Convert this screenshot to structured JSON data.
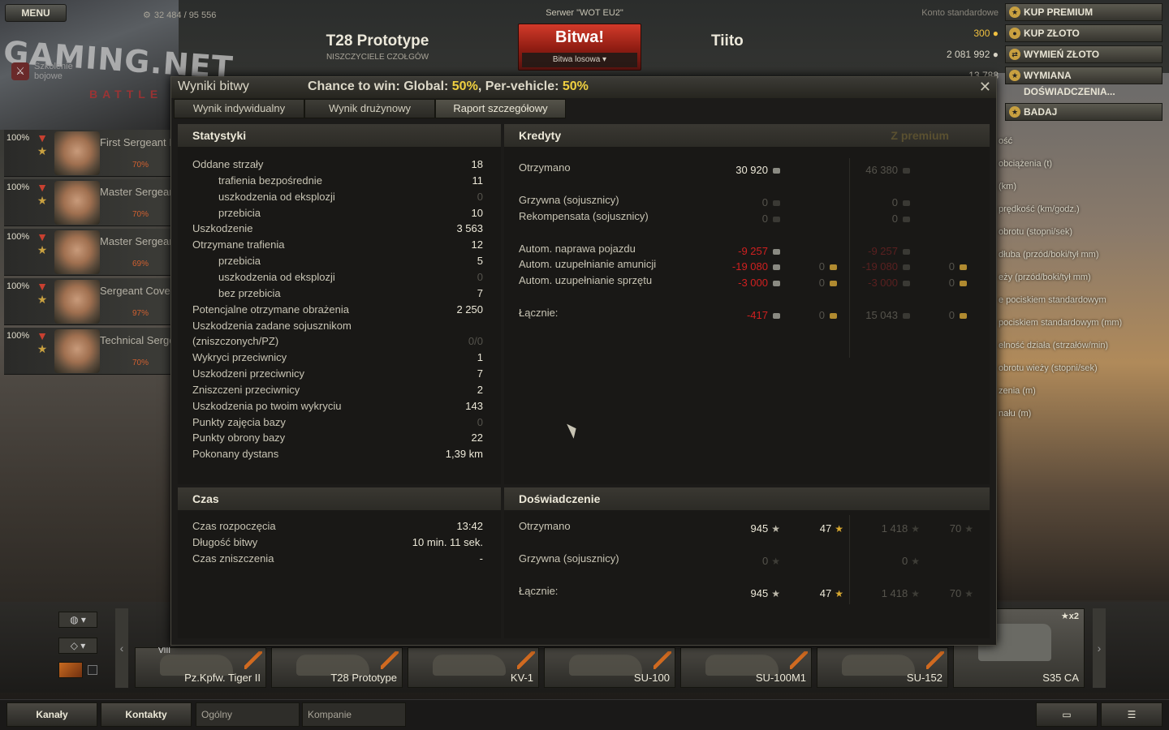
{
  "topbar": {
    "menu_label": "MENU",
    "free_xp_progress": "32 484 / 95 556",
    "server": "Serwer \"WOT EU2\"",
    "battle_label": "Bitwa!",
    "battle_mode": "Bitwa losowa",
    "tank_name": "T28 Prototype",
    "tank_class": "NISZCZYCIELE CZOŁGÓW",
    "player_name": "Tiito",
    "account_type": "Konto standardowe",
    "gold": "300",
    "credits": "2 081 992",
    "free_xp": "13 788"
  },
  "right_buttons": {
    "premium": "KUP PREMIUM",
    "gold": "KUP ZŁOTO",
    "exchange": "WYMIEŃ ZŁOTO",
    "xp_exchange": "WYMIANA DOŚWIADCZENIA...",
    "research": "BADAJ"
  },
  "right_list": [
    "ość",
    "obciążenia (t)",
    "(km)",
    "prędkość (km/godz.)",
    "obrotu (stopni/sek)",
    "dłuba (przód/boki/tył mm)",
    "eży (przód/boki/tył mm)",
    "e pociskiem standardowym",
    "pociskiem standardowym (mm)",
    "elność działa (strzałów/min)",
    "obrotu wieży (stopni/sek)",
    "zenia (m)",
    "nału (m)"
  ],
  "school": "Szkolenie bojowe",
  "gaming_logo": "GAMING.NET",
  "gaming_sub": "BATTLE",
  "crew": [
    {
      "pct": "100%",
      "name": "First Sergeant I",
      "skill": "70%"
    },
    {
      "pct": "100%",
      "name": "Master Sergeant",
      "skill": "70%"
    },
    {
      "pct": "100%",
      "name": "Master Sergeant",
      "skill": "69%"
    },
    {
      "pct": "100%",
      "name": "Sergeant Cover",
      "skill": "97%"
    },
    {
      "pct": "100%",
      "name": "Technical Serge",
      "skill": "70%"
    }
  ],
  "dialog": {
    "title": "Wyniki bitwy",
    "chance_prefix": "Chance to win: Global: ",
    "chance_global": "50%",
    "chance_mid": ", Per-vehicle: ",
    "chance_vehicle": "50%",
    "close": "✕",
    "tabs": [
      "Wynik indywidualny",
      "Wynik drużynowy",
      "Raport szczegółowy"
    ]
  },
  "stats": {
    "title": "Statystyki",
    "rows": [
      {
        "label": "Oddane strzały",
        "value": "18",
        "indent": false,
        "dim": false
      },
      {
        "label": "trafienia bezpośrednie",
        "value": "11",
        "indent": true,
        "dim": false
      },
      {
        "label": "uszkodzenia od eksplozji",
        "value": "0",
        "indent": true,
        "dim": true
      },
      {
        "label": "przebicia",
        "value": "10",
        "indent": true,
        "dim": false
      },
      {
        "label": "Uszkodzenie",
        "value": "3 563",
        "indent": false,
        "dim": false
      },
      {
        "label": "Otrzymane trafienia",
        "value": "12",
        "indent": false,
        "dim": false
      },
      {
        "label": "przebicia",
        "value": "5",
        "indent": true,
        "dim": false
      },
      {
        "label": "uszkodzenia od eksplozji",
        "value": "0",
        "indent": true,
        "dim": true
      },
      {
        "label": "bez przebicia",
        "value": "7",
        "indent": true,
        "dim": false
      },
      {
        "label": "Potencjalne otrzymane obrażenia",
        "value": "2 250",
        "indent": false,
        "dim": false
      },
      {
        "label": "Uszkodzenia zadane sojusznikom",
        "value": "",
        "indent": false,
        "dim": false
      },
      {
        "label": "(zniszczonych/PZ)",
        "value": "0/0",
        "indent": false,
        "dim": true
      },
      {
        "label": "Wykryci przeciwnicy",
        "value": "1",
        "indent": false,
        "dim": false
      },
      {
        "label": "Uszkodzeni przeciwnicy",
        "value": "7",
        "indent": false,
        "dim": false
      },
      {
        "label": "Zniszczeni przeciwnicy",
        "value": "2",
        "indent": false,
        "dim": false
      },
      {
        "label": "Uszkodzenia po twoim wykryciu",
        "value": "143",
        "indent": false,
        "dim": false
      },
      {
        "label": "Punkty zajęcia bazy",
        "value": "0",
        "indent": false,
        "dim": true
      },
      {
        "label": "Punkty obrony bazy",
        "value": "22",
        "indent": false,
        "dim": false
      },
      {
        "label": "Pokonany dystans",
        "value": "1,39 km",
        "indent": false,
        "dim": false
      }
    ]
  },
  "credits": {
    "title": "Kredyty",
    "premium_label": "Z premium",
    "received": {
      "label": "Otrzymano",
      "value": "30 920",
      "prem": "46 380"
    },
    "fine": {
      "label": "Grzywna (sojusznicy)",
      "value": "0",
      "gold": "0",
      "prem": "0"
    },
    "comp": {
      "label": "Rekompensata (sojusznicy)",
      "value": "0",
      "gold": "0",
      "prem": "0"
    },
    "repair": {
      "label": "Autom. naprawa pojazdu",
      "value": "-9 257",
      "prem": "-9 257"
    },
    "ammo": {
      "label": "Autom. uzupełnianie amunicji",
      "value": "-19 080",
      "gold": "0",
      "prem": "-19 080",
      "prem_gold": "0"
    },
    "equip": {
      "label": "Autom. uzupełnianie sprzętu",
      "value": "-3 000",
      "gold": "0",
      "prem": "-3 000",
      "prem_gold": "0"
    },
    "total": {
      "label": "Łącznie:",
      "value": "-417",
      "gold": "0",
      "prem": "15 043",
      "prem_gold": "0"
    }
  },
  "time": {
    "title": "Czas",
    "rows": [
      {
        "label": "Czas rozpoczęcia",
        "value": "13:42"
      },
      {
        "label": "Długość bitwy",
        "value": "10 min. 11 sek."
      },
      {
        "label": "Czas zniszczenia",
        "value": "-"
      }
    ]
  },
  "experience": {
    "title": "Doświadczenie",
    "received": {
      "label": "Otrzymano",
      "xp": "945",
      "free": "47",
      "prem_xp": "1 418",
      "prem_free": "70"
    },
    "fine": {
      "label": "Grzywna (sojusznicy)",
      "xp": "0",
      "prem_xp": "0"
    },
    "total": {
      "label": "Łącznie:",
      "xp": "945",
      "free": "47",
      "prem_xp": "1 418",
      "prem_free": "70"
    }
  },
  "carousel": {
    "tier_badge": "VIII",
    "vehicles": [
      "Pz.Kpfw. Tiger II",
      "T28 Prototype",
      "KV-1",
      "SU-100",
      "SU-100M1",
      "SU-152"
    ],
    "selected_vehicle": "S35 CA",
    "xp_multiplier": "★x2"
  },
  "bottom": {
    "channels": "Kanały",
    "contacts": "Kontakty",
    "general": "Ogólny",
    "companies": "Kompanie"
  },
  "colors": {
    "gold": "#f0c040",
    "negative": "#d02020",
    "battle": "#c0301e"
  }
}
